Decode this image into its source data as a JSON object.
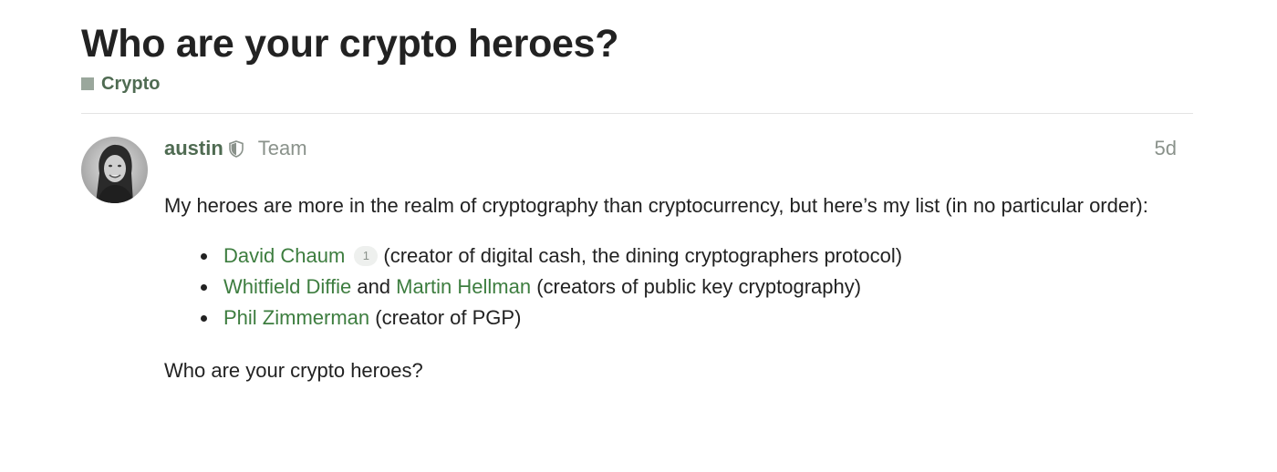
{
  "topic": {
    "title": "Who are your crypto heroes?",
    "category": {
      "name": "Crypto",
      "color": "#9aa79c"
    }
  },
  "post": {
    "author": {
      "username": "austin",
      "badge_icon": "shield-icon",
      "user_title": "Team"
    },
    "date": "5d",
    "intro": "My heroes are more in the realm of cryptography than cryptocurrency, but here’s my list (in no particular order):",
    "heroes": [
      {
        "link": "David Chaum",
        "click_count": "1",
        "desc": "(creator of digital cash, the dining cryptographers protocol)"
      },
      {
        "link": "Whitfield Diffie",
        "joiner": "and",
        "link2": "Martin Hellman",
        "desc": "(creators of public key cryptography)"
      },
      {
        "link": "Phil Zimmerman",
        "desc": "(creator of PGP)"
      }
    ],
    "closing": "Who are your crypto heroes?"
  },
  "colors": {
    "link": "#3d7d3f",
    "username": "#4f6b52",
    "muted": "#8a928b",
    "text": "#222222"
  }
}
